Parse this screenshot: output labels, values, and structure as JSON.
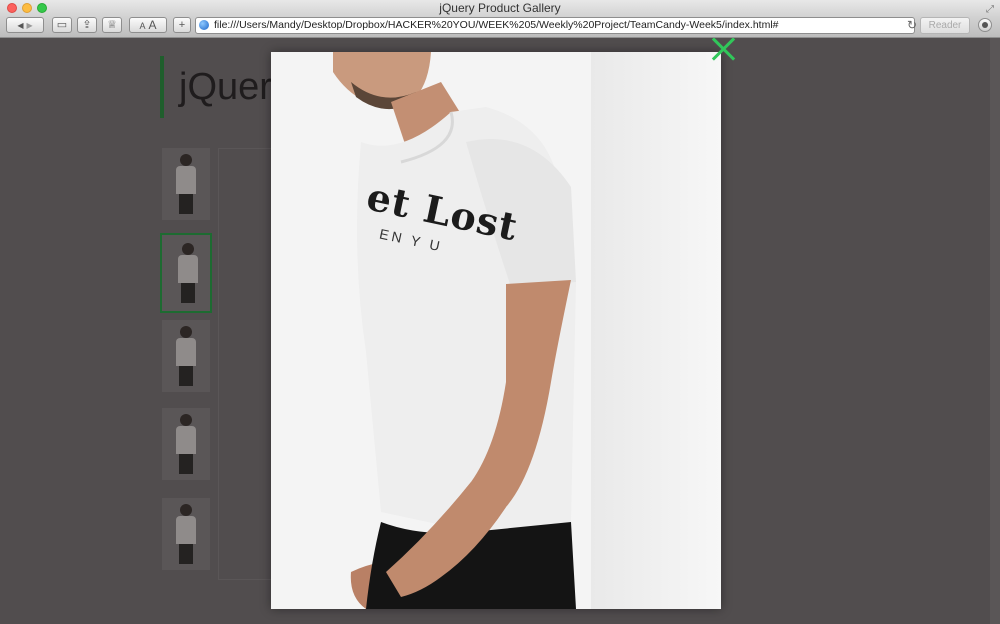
{
  "window": {
    "title": "jQuery Product Gallery"
  },
  "toolbar": {
    "back_label": "◀",
    "forward_label": "▶",
    "text_small": "A",
    "text_large": "A",
    "add_label": "+",
    "url": "file:///Users/Mandy/Desktop/Dropbox/HACKER%20YOU/WEEK%205/Weekly%20Project/TeamCandy-Week5/index.html#",
    "reader_label": "Reader",
    "reload_icon": "↻"
  },
  "page": {
    "heading": "jQuery",
    "thumbnails_count": 5,
    "selected_thumbnail": 2
  },
  "lightbox": {
    "shirt_print_main": "et Lost",
    "shirt_print_sub": "EN Y U",
    "close_color": "#31c75a"
  }
}
